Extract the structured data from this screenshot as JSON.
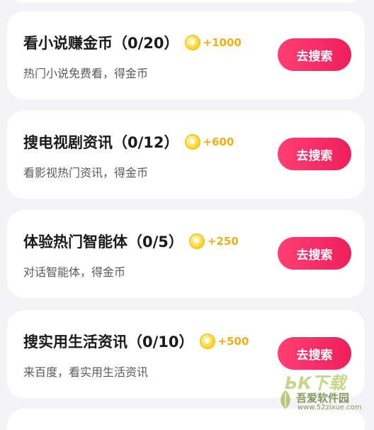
{
  "tasks": [
    {
      "title": "看小说赚金币（0/20）",
      "coin_symbol": "¥",
      "reward": "+1000",
      "description": "热门小说免费看，得金币",
      "button_label": "去搜索"
    },
    {
      "title": "搜电视剧资讯（0/12）",
      "coin_symbol": "¥",
      "reward": "+600",
      "description": "看影视热门资讯，得金币",
      "button_label": "去搜索"
    },
    {
      "title": "体验热门智能体（0/5）",
      "coin_symbol": "¥",
      "reward": "+250",
      "description": "对话智能体，得金币",
      "button_label": "去搜索"
    },
    {
      "title": "搜实用生活资讯（0/10）",
      "coin_symbol": "¥",
      "reward": "+500",
      "description": "来百度，看实用生活资讯",
      "button_label": "去搜索"
    }
  ],
  "watermark": {
    "main": "ЬК下载",
    "site": "吾爱软件园",
    "url": "www.52zixue.com"
  },
  "colors": {
    "accent_button": "#ee1f5c",
    "reward_gold": "#f3ad16",
    "page_background": "#f4f4f6"
  }
}
